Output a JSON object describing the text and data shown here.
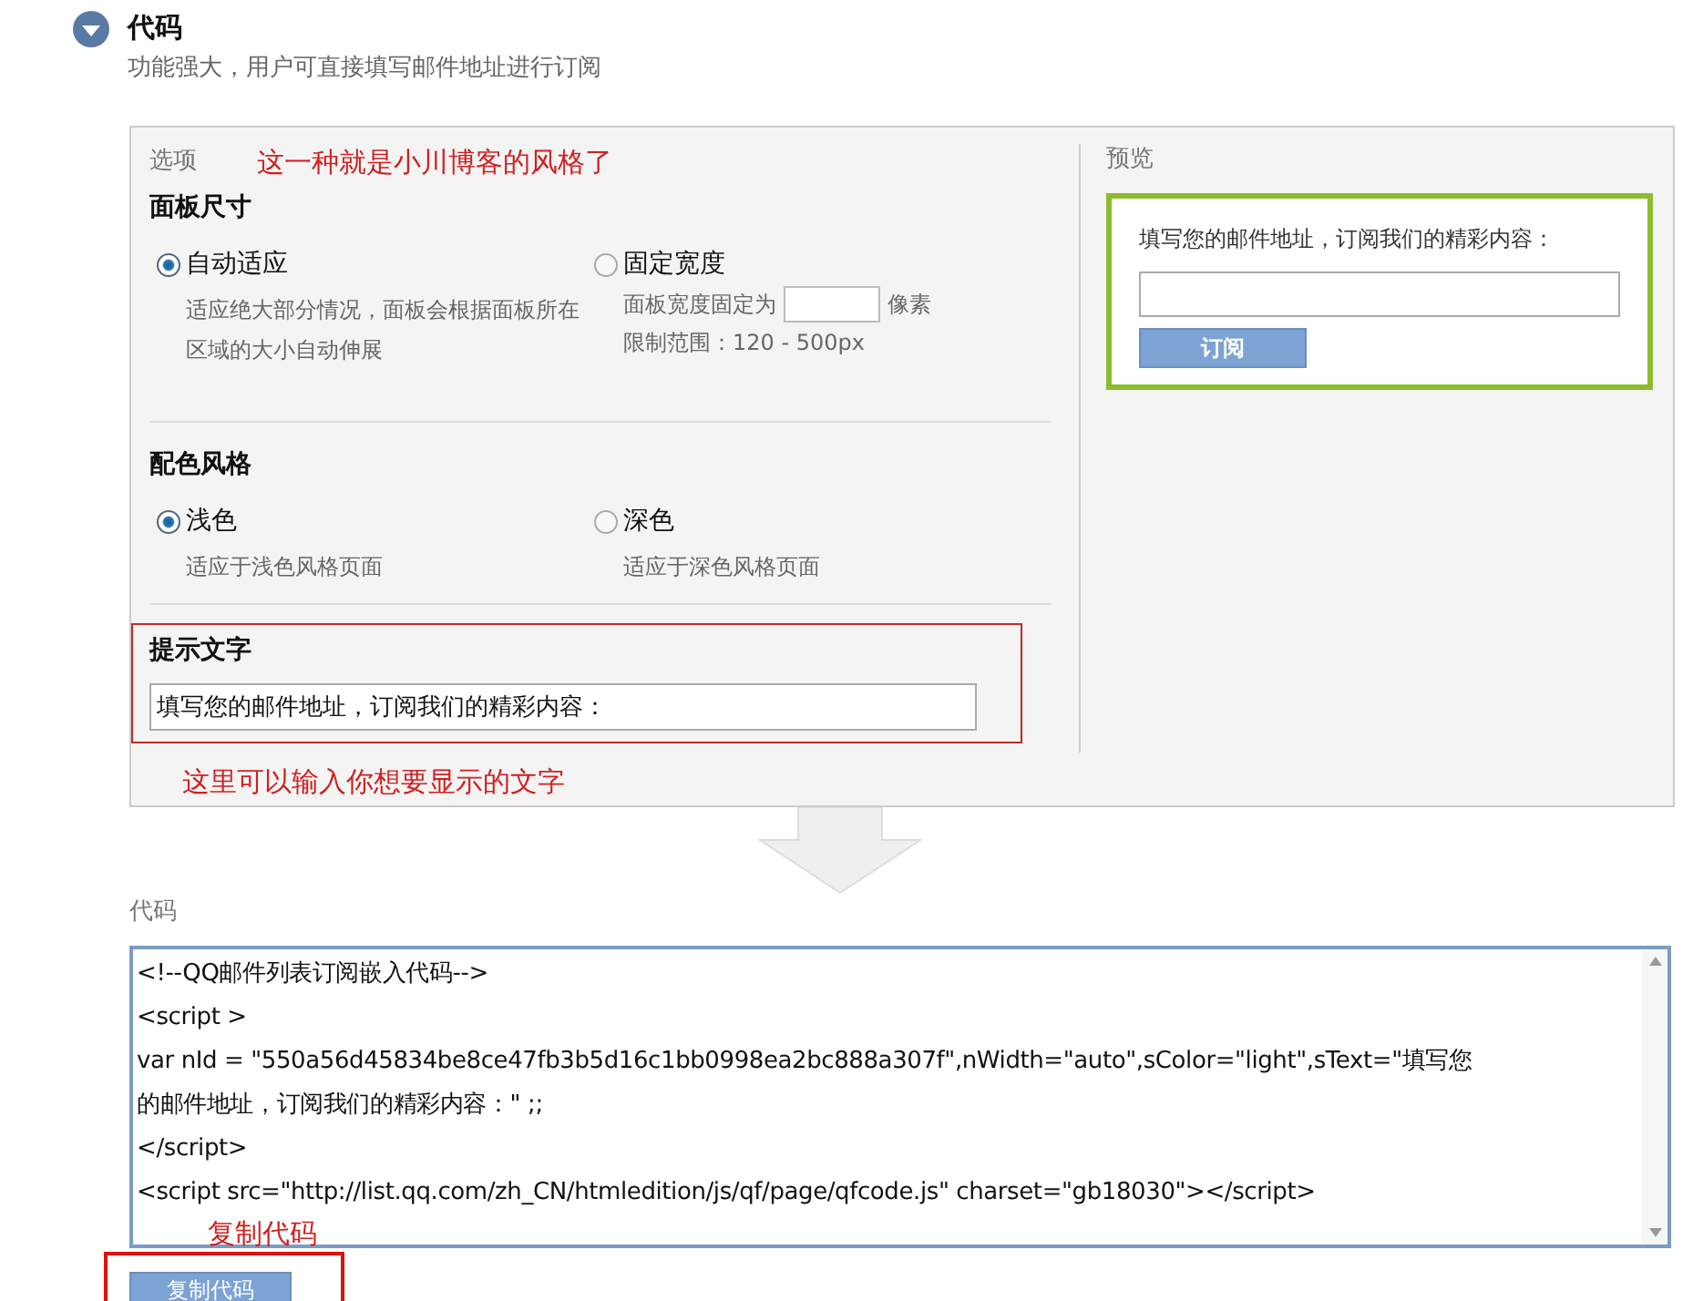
{
  "header": {
    "title": "代码",
    "subtitle": "功能强大，用户可直接填写邮件地址进行订阅"
  },
  "options": {
    "label": "选项",
    "annotation": "这一种就是小川博客的风格了",
    "groups": [
      {
        "title": "面板尺寸",
        "options": [
          {
            "kind": "plain",
            "label": "自动适应",
            "selected": true,
            "description": "适应绝大部分情况，面板会根据面板所在区域的大小自动伸展"
          },
          {
            "kind": "fixed_width",
            "label": "固定宽度",
            "selected": false,
            "prefix": "面板宽度固定为",
            "suffix": "像素",
            "range": "限制范围：120 - 500px"
          }
        ]
      },
      {
        "title": "配色风格",
        "options": [
          {
            "kind": "plain",
            "label": "浅色",
            "selected": true,
            "description": "适应于浅色风格页面"
          },
          {
            "kind": "plain",
            "label": "深色",
            "selected": false,
            "description": "适应于深色风格页面"
          }
        ]
      }
    ],
    "hint": {
      "title": "提示文字",
      "value": "填写您的邮件地址，订阅我们的精彩内容：",
      "annotation": "这里可以输入你想要显示的文字"
    }
  },
  "preview": {
    "label": "预览",
    "prompt": "填写您的邮件地址，订阅我们的精彩内容：",
    "button": "订阅"
  },
  "code": {
    "label": "代码",
    "lines": [
      "<!--QQ邮件列表订阅嵌入代码-->",
      "<script >",
      "var nId = \"550a56d45834be8ce47fb3b5d16c1bb0998ea2bc888a307f\",nWidth=\"auto\",sColor=\"light\",sText=\"填写您",
      "的邮件地址，订阅我们的精彩内容：\" ;;",
      "</script>",
      "<script src=\"http://list.qq.com/zh_CN/htmledition/js/qf/page/qfcode.js\" charset=\"gb18030\"></script>"
    ],
    "annotation": "复制代码",
    "button": "复制代码"
  }
}
